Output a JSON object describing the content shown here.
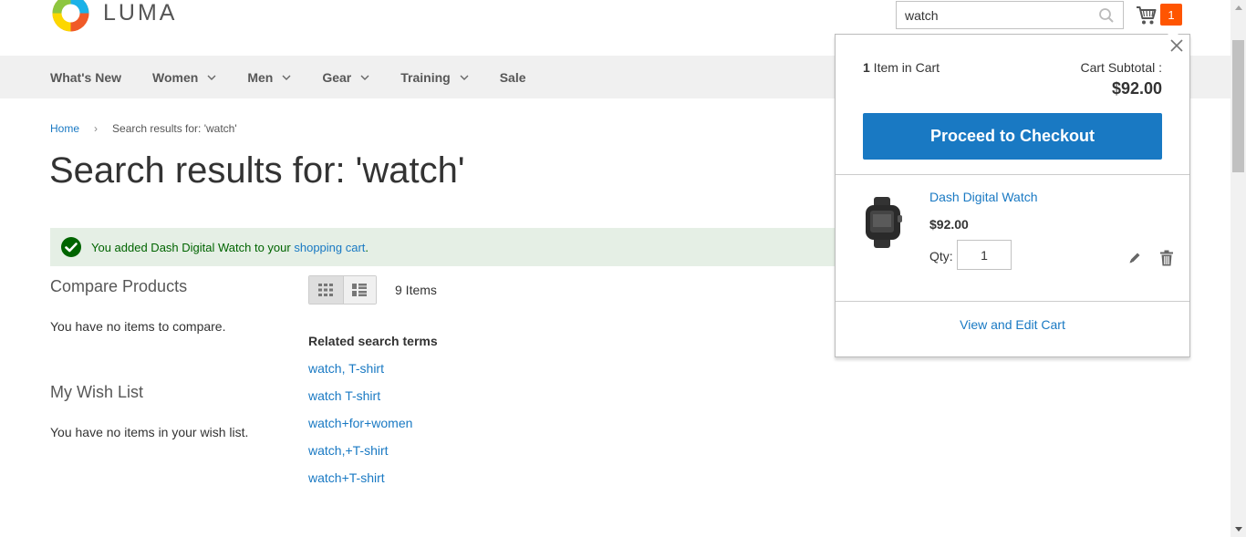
{
  "brand": {
    "name": "LUMA"
  },
  "search": {
    "value": "watch"
  },
  "cart": {
    "count": "1"
  },
  "nav": {
    "items": [
      {
        "label": "What's New",
        "dropdown": false
      },
      {
        "label": "Women",
        "dropdown": true
      },
      {
        "label": "Men",
        "dropdown": true
      },
      {
        "label": "Gear",
        "dropdown": true
      },
      {
        "label": "Training",
        "dropdown": true
      },
      {
        "label": "Sale",
        "dropdown": false
      }
    ]
  },
  "breadcrumb": {
    "home": "Home",
    "current": "Search results for: 'watch'"
  },
  "page": {
    "title": "Search results for: 'watch'"
  },
  "message": {
    "prefix": "You added Dash Digital Watch to your ",
    "link": "shopping cart",
    "suffix": "."
  },
  "sidebar": {
    "compare_title": "Compare Products",
    "compare_empty": "You have no items to compare.",
    "wishlist_title": "My Wish List",
    "wishlist_empty": "You have no items in your wish list."
  },
  "toolbar": {
    "item_count": "9 Items"
  },
  "related": {
    "title": "Related search terms",
    "terms": [
      "watch, T-shirt",
      "watch T-shirt",
      "watch+for+women",
      "watch,+T-shirt",
      "watch+T-shirt"
    ]
  },
  "minicart": {
    "count_number": "1",
    "count_label": " Item in Cart",
    "subtotal_label": "Cart Subtotal :",
    "subtotal_amount": "$92.00",
    "checkout_label": "Proceed to Checkout",
    "item": {
      "name": "Dash Digital Watch",
      "price": "$92.00",
      "qty_label": "Qty:",
      "qty_value": "1"
    },
    "view_cart_label": "View and Edit Cart"
  },
  "colors": {
    "accent": "#1979c3",
    "cart_badge": "#ff5501",
    "success_bg": "#e5efe5",
    "success_icon": "#006400",
    "nav_bg": "#f0f0f0"
  }
}
